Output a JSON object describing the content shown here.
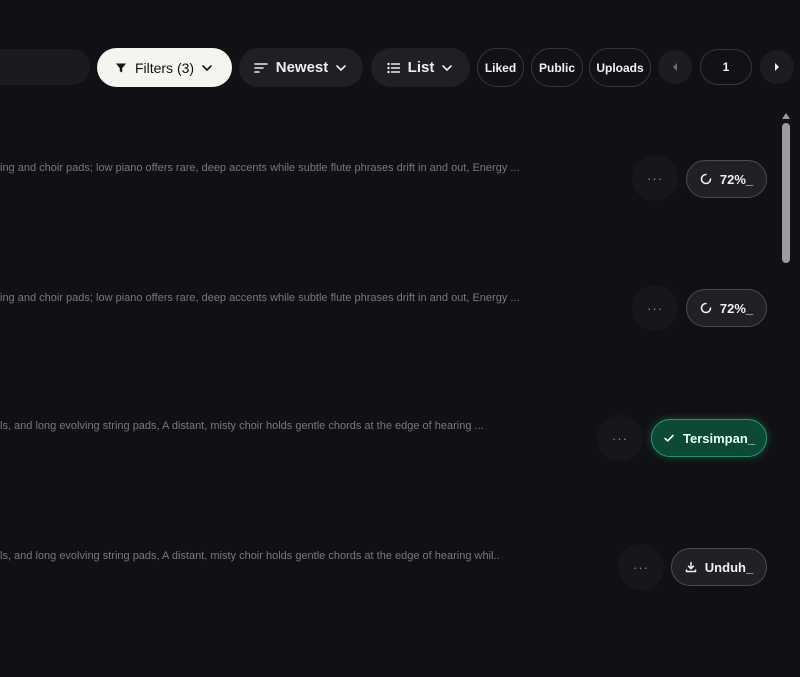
{
  "toolbar": {
    "filters_label": "Filters (3)",
    "sort_label": "Newest",
    "view_label": "List",
    "chips": {
      "liked": "Liked",
      "public": "Public",
      "uploads": "Uploads"
    },
    "page_number": "1"
  },
  "rows": [
    {
      "description": "ing and choir pads; low piano offers rare, deep accents while subtle flute phrases drift in and out, Energy ...",
      "status_label": "72%_",
      "status_icon": "spinner-icon"
    },
    {
      "description": "ing and choir pads; low piano offers rare, deep accents while subtle flute phrases drift in and out, Energy ...",
      "status_label": "72%_",
      "status_icon": "spinner-icon"
    },
    {
      "description": "ls, and long evolving string pads, A distant, misty choir holds gentle chords at the edge of hearing ...",
      "status_label": "Tersimpan_",
      "status_icon": "check-icon"
    },
    {
      "description": "ls, and long evolving string pads, A distant, misty choir holds gentle chords at the edge of hearing whil...",
      "status_label": "Unduh_",
      "status_icon": "download-icon"
    }
  ],
  "more_label": "···",
  "colors": {
    "background": "#111115",
    "saved_green": "#1f9a6b",
    "filters_bg": "#f6f4ee"
  }
}
